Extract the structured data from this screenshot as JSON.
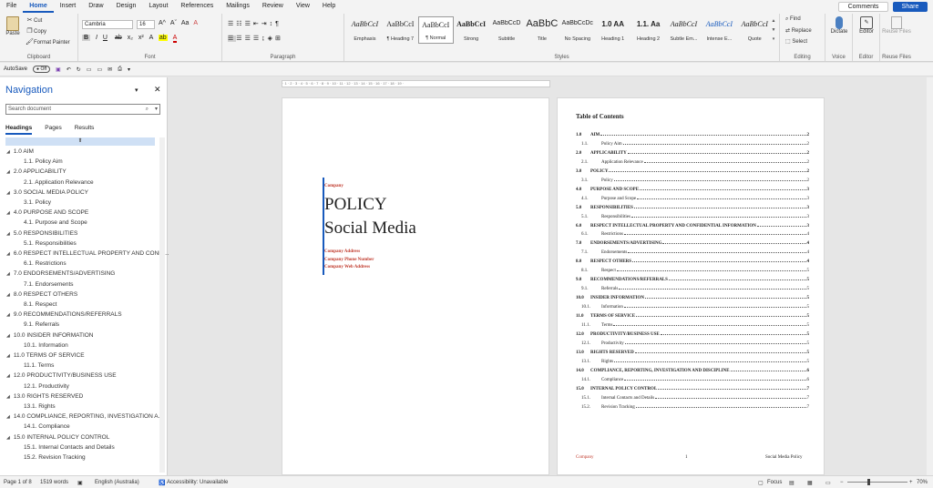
{
  "tabs": [
    "File",
    "Home",
    "Insert",
    "Draw",
    "Design",
    "Layout",
    "References",
    "Mailings",
    "Review",
    "View",
    "Help"
  ],
  "top_buttons": {
    "comments": "Comments",
    "share": "Share"
  },
  "clipboard": {
    "paste": "Paste",
    "cut": "Cut",
    "copy": "Copy",
    "format_painter": "Format Painter",
    "label": "Clipboard"
  },
  "font": {
    "name": "Cambria",
    "size": "16",
    "label": "Font",
    "bold": "B",
    "italic": "I",
    "underline": "U",
    "strike": "ab",
    "sub": "x₂",
    "sup": "x²"
  },
  "paragraph": {
    "label": "Paragraph"
  },
  "styles": {
    "label": "Styles",
    "items": [
      {
        "preview": "AaBbCcI",
        "name": "Emphasis"
      },
      {
        "preview": "AaBbCcI",
        "name": "¶ Heading 7"
      },
      {
        "preview": "AaBbCcI",
        "name": "¶ Normal"
      },
      {
        "preview": "AaBbCcI",
        "name": "Strong"
      },
      {
        "preview": "AaBbCcD",
        "name": "Subtitle"
      },
      {
        "preview": "AaBbC",
        "name": "Title"
      },
      {
        "preview": "AaBbCcDc",
        "name": "No Spacing"
      },
      {
        "preview": "1.0 AA",
        "name": "Heading 1"
      },
      {
        "preview": "1.1. Aa",
        "name": "Heading 2"
      },
      {
        "preview": "AaBbCcI",
        "name": "Subtle Em..."
      },
      {
        "preview": "AaBbCcI",
        "name": "Intense E..."
      },
      {
        "preview": "AaBbCcI",
        "name": "Quote"
      }
    ]
  },
  "editing": {
    "find": "Find",
    "replace": "Replace",
    "select": "Select",
    "label": "Editing"
  },
  "voice": {
    "dictate": "Dictate",
    "label": "Voice"
  },
  "editor": {
    "editor": "Editor",
    "label": "Editor"
  },
  "reuse": {
    "reuse": "Reuse Files",
    "label": "Reuse Files"
  },
  "qat": {
    "autosave": "AutoSave",
    "toggle": "Off"
  },
  "navigation": {
    "title": "Navigation",
    "search_placeholder": "Search document",
    "tabs": [
      "Headings",
      "Pages",
      "Results"
    ],
    "headings": [
      {
        "text": "1.0 AIM",
        "level": 1
      },
      {
        "text": "1.1. Policy Aim",
        "level": 2
      },
      {
        "text": "2.0 APPLICABILITY",
        "level": 1
      },
      {
        "text": "2.1. Application Relevance",
        "level": 2
      },
      {
        "text": "3.0 SOCIAL MEDIA POLICY",
        "level": 1
      },
      {
        "text": "3.1. Policy",
        "level": 2
      },
      {
        "text": "4.0 PURPOSE AND SCOPE",
        "level": 1
      },
      {
        "text": "4.1. Purpose and Scope",
        "level": 2
      },
      {
        "text": "5.0 RESPONSIBILITIES",
        "level": 1
      },
      {
        "text": "5.1. Responsibilities",
        "level": 2
      },
      {
        "text": "6.0 RESPECT INTELLECTUAL PROPERTY AND CONFI...",
        "level": 1
      },
      {
        "text": "6.1. Restrictions",
        "level": 2
      },
      {
        "text": "7.0 ENDORSEMENTS/ADVERTISING",
        "level": 1
      },
      {
        "text": "7.1. Endorsements",
        "level": 2
      },
      {
        "text": "8.0 RESPECT OTHERS",
        "level": 1
      },
      {
        "text": "8.1. Respect",
        "level": 2
      },
      {
        "text": "9.0 RECOMMENDATIONS/REFERRALS",
        "level": 1
      },
      {
        "text": "9.1. Referrals",
        "level": 2
      },
      {
        "text": "10.0 INSIDER INFORMATION",
        "level": 1
      },
      {
        "text": "10.1. Information",
        "level": 2
      },
      {
        "text": "11.0 TERMS OF SERVICE",
        "level": 1
      },
      {
        "text": "11.1. Terms",
        "level": 2
      },
      {
        "text": "12.0 PRODUCTIVITY/BUSINESS USE",
        "level": 1
      },
      {
        "text": "12.1. Productivity",
        "level": 2
      },
      {
        "text": "13.0 RIGHTS RESERVED",
        "level": 1
      },
      {
        "text": "13.1. Rights",
        "level": 2
      },
      {
        "text": "14.0 COMPLIANCE, REPORTING, INVESTIGATION A...",
        "level": 1
      },
      {
        "text": "14.1. Compliance",
        "level": 2
      },
      {
        "text": "15.0 INTERNAL POLICY CONTROL",
        "level": 1
      },
      {
        "text": "15.1. Internal Contacts and Details",
        "level": 2
      },
      {
        "text": "15.2. Revision Tracking",
        "level": 2
      }
    ]
  },
  "cover": {
    "company": "Company",
    "title1": "POLICY",
    "title2": "Social Media",
    "address": "Company Address",
    "phone": "Company Phone Number",
    "web": "Company Web Address"
  },
  "toc": {
    "title": "Table of Contents",
    "entries": [
      {
        "num": "1.0",
        "text": "AIM",
        "page": "2",
        "level": 1
      },
      {
        "num": "1.1.",
        "text": "Policy Aim",
        "page": "2",
        "level": 2
      },
      {
        "num": "2.0",
        "text": "APPLICABILITY",
        "page": "2",
        "level": 1
      },
      {
        "num": "2.1.",
        "text": "Application Relevance",
        "page": "2",
        "level": 2
      },
      {
        "num": "3.0",
        "text": "POLICY",
        "page": "2",
        "level": 1
      },
      {
        "num": "3.1.",
        "text": "Policy",
        "page": "2",
        "level": 2
      },
      {
        "num": "4.0",
        "text": "PURPOSE AND SCOPE",
        "page": "3",
        "level": 1
      },
      {
        "num": "4.1.",
        "text": "Purpose and Scope",
        "page": "3",
        "level": 2
      },
      {
        "num": "5.0",
        "text": "RESPONSIBILITIES",
        "page": "3",
        "level": 1
      },
      {
        "num": "5.1.",
        "text": "Responsibilities",
        "page": "3",
        "level": 2
      },
      {
        "num": "6.0",
        "text": "RESPECT INTELLECTUAL PROPERTY AND CONFIDENTIAL INFORMATION",
        "page": "3",
        "level": 1
      },
      {
        "num": "6.1.",
        "text": "Restrictions",
        "page": "4",
        "level": 2
      },
      {
        "num": "7.0",
        "text": "ENDORSEMENTS/ADVERTISING",
        "page": "4",
        "level": 1
      },
      {
        "num": "7.1.",
        "text": "Endorsements",
        "page": "4",
        "level": 2
      },
      {
        "num": "8.0",
        "text": "RESPECT OTHERS",
        "page": "4",
        "level": 1
      },
      {
        "num": "8.1.",
        "text": "Respect",
        "page": "5",
        "level": 2
      },
      {
        "num": "9.0",
        "text": "RECOMMENDATIONS/REFERRALS",
        "page": "5",
        "level": 1
      },
      {
        "num": "9.1.",
        "text": "Referrals",
        "page": "5",
        "level": 2
      },
      {
        "num": "10.0",
        "text": "INSIDER INFORMATION",
        "page": "5",
        "level": 1
      },
      {
        "num": "10.1.",
        "text": "Information",
        "page": "5",
        "level": 2
      },
      {
        "num": "11.0",
        "text": "TERMS OF SERVICE",
        "page": "5",
        "level": 1
      },
      {
        "num": "11.1.",
        "text": "Terms",
        "page": "5",
        "level": 2
      },
      {
        "num": "12.0",
        "text": "PRODUCTIVITY/BUSINESS USE",
        "page": "5",
        "level": 1
      },
      {
        "num": "12.1.",
        "text": "Productivity",
        "page": "5",
        "level": 2
      },
      {
        "num": "13.0",
        "text": "RIGHTS RESERVED",
        "page": "5",
        "level": 1
      },
      {
        "num": "13.1.",
        "text": "Rights",
        "page": "5",
        "level": 2
      },
      {
        "num": "14.0",
        "text": "COMPLIANCE, REPORTING, INVESTIGATION AND DISCIPLINE",
        "page": "6",
        "level": 1
      },
      {
        "num": "14.1.",
        "text": "Compliance",
        "page": "6",
        "level": 2
      },
      {
        "num": "15.0",
        "text": "INTERNAL POLICY CONTROL",
        "page": "7",
        "level": 1
      },
      {
        "num": "15.1.",
        "text": "Internal Contacts and Details",
        "page": "7",
        "level": 2
      },
      {
        "num": "15.2.",
        "text": "Revision Tracking",
        "page": "7",
        "level": 2
      }
    ],
    "footer_left": "Company",
    "footer_center": "1",
    "footer_right": "Social Media Policy"
  },
  "status": {
    "page": "Page 1 of 8",
    "words": "1519 words",
    "language": "English (Australia)",
    "accessibility": "Accessibility: Unavailable",
    "focus": "Focus",
    "zoom": "70%"
  }
}
